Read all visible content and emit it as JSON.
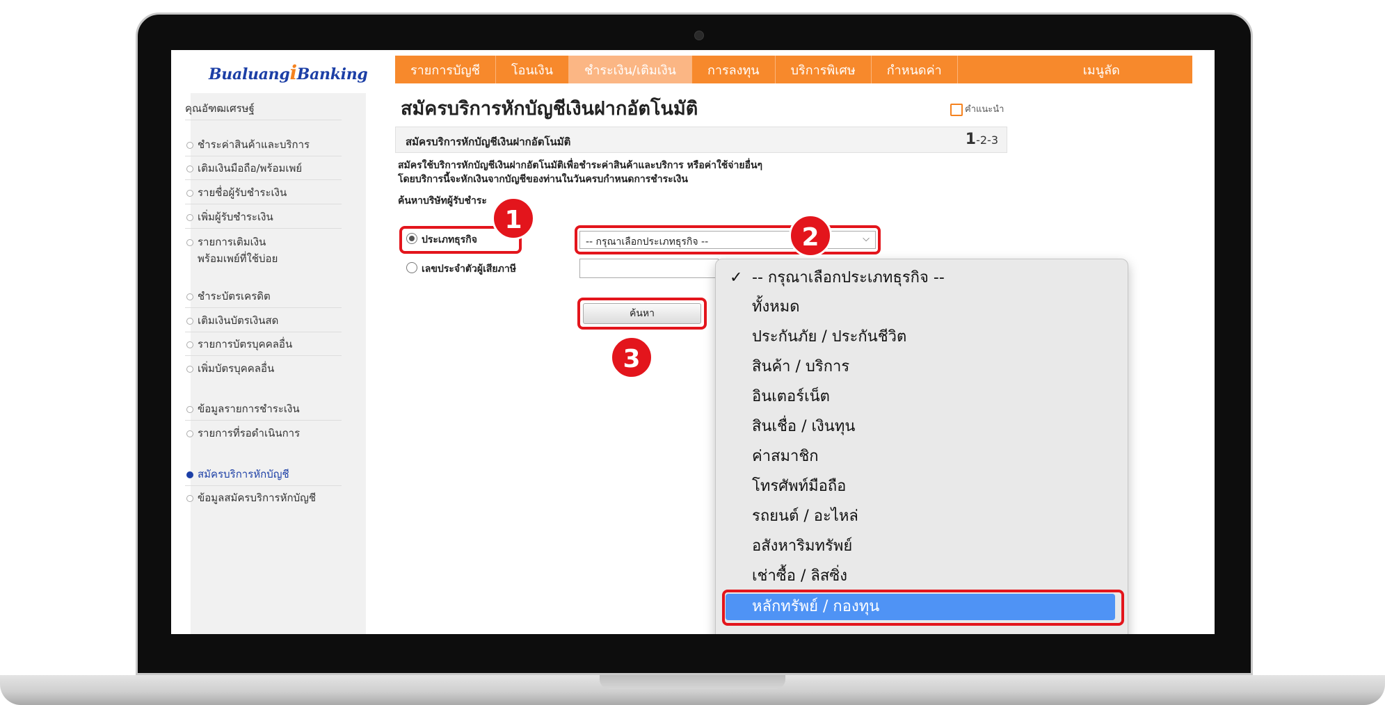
{
  "brand": {
    "logo_part1": "Bualuang",
    "logo_i": "i",
    "logo_part2": "Banking",
    "logo_color": "#1c3fa6",
    "accent_color": "#f7892c"
  },
  "topnav": [
    {
      "label": "รายการบัญชี"
    },
    {
      "label": "โอนเงิน"
    },
    {
      "label": "ชำระเงิน/เติมเงิน"
    },
    {
      "label": "การลงทุน"
    },
    {
      "label": "บริการพิเศษ"
    },
    {
      "label": "กำหนดค่า"
    },
    {
      "label": "เมนูลัด"
    }
  ],
  "sidebar": {
    "user_name": "คุณอัฑฒเศรษฐ์",
    "group1": [
      "ชำระค่าสินค้าและบริการ",
      "เติมเงินมือถือ/พร้อมเพย์",
      "รายชื่อผู้รับชำระเงิน",
      "เพิ่มผู้รับชำระเงิน",
      "รายการเติมเงิน",
      "พร้อมเพย์ที่ใช้บ่อย"
    ],
    "group2": [
      "ชำระบัตรเครดิต",
      "เติมเงินบัตรเงินสด",
      "รายการบัตรบุคคลอื่น",
      "เพิ่มบัตรบุคคลอื่น"
    ],
    "group3": [
      "ข้อมูลรายการชำระเงิน",
      "รายการที่รอดำเนินการ"
    ],
    "group4": [
      "สมัครบริการหักบัญชี",
      "ข้อมูลสมัครบริการหักบัญชี"
    ]
  },
  "main": {
    "title": "สมัครบริการหักบัญชีเงินฝากอัตโนมัติ",
    "help_label": "คำแนะนำ",
    "step_title": "สมัครบริการหักบัญชีเงินฝากอัตโนมัติ",
    "step_current": "1",
    "step_rest": "-2-3",
    "desc_line1": "สมัครใช้บริการหักบัญชีเงินฝากอัตโนมัติเพื่อชำระค่าสินค้าและบริการ หรือค่าใช้จ่ายอื่นๆ",
    "desc_line2": "โดยบริการนี้จะหักเงินจากบัญชีของท่านในวันครบกำหนดการชำระเงิน",
    "search_label": "ค้นหาบริษัทผู้รับชำระ",
    "radio_business_type": "ประเภทธุรกิจ",
    "radio_tax_id": "เลขประจำตัวผู้เสียภาษี",
    "select_value": "-- กรุณาเลือกประเภทธุรกิจ --",
    "search_button": "ค้นหา"
  },
  "dropdown": {
    "check_mark": "✓",
    "options": [
      "-- กรุณาเลือกประเภทธุรกิจ --",
      "ทั้งหมด",
      "ประกันภัย / ประกันชีวิต",
      "สินค้า / บริการ",
      "อินเตอร์เน็ต",
      "สินเชื่อ / เงินทุน",
      "ค่าสมาชิก",
      "โทรศัพท์มือถือ",
      "รถยนต์ / อะไหล่",
      "อสังหาริมทรัพย์",
      "เช่าซื้อ / ลิสซิ่ง",
      "หลักทรัพย์ / กองทุน"
    ],
    "selected_index": 11,
    "highlight_color": "#4f93f5"
  },
  "annotations": {
    "badge1": "1",
    "badge2": "2",
    "badge3": "3",
    "color": "#e3151c"
  }
}
